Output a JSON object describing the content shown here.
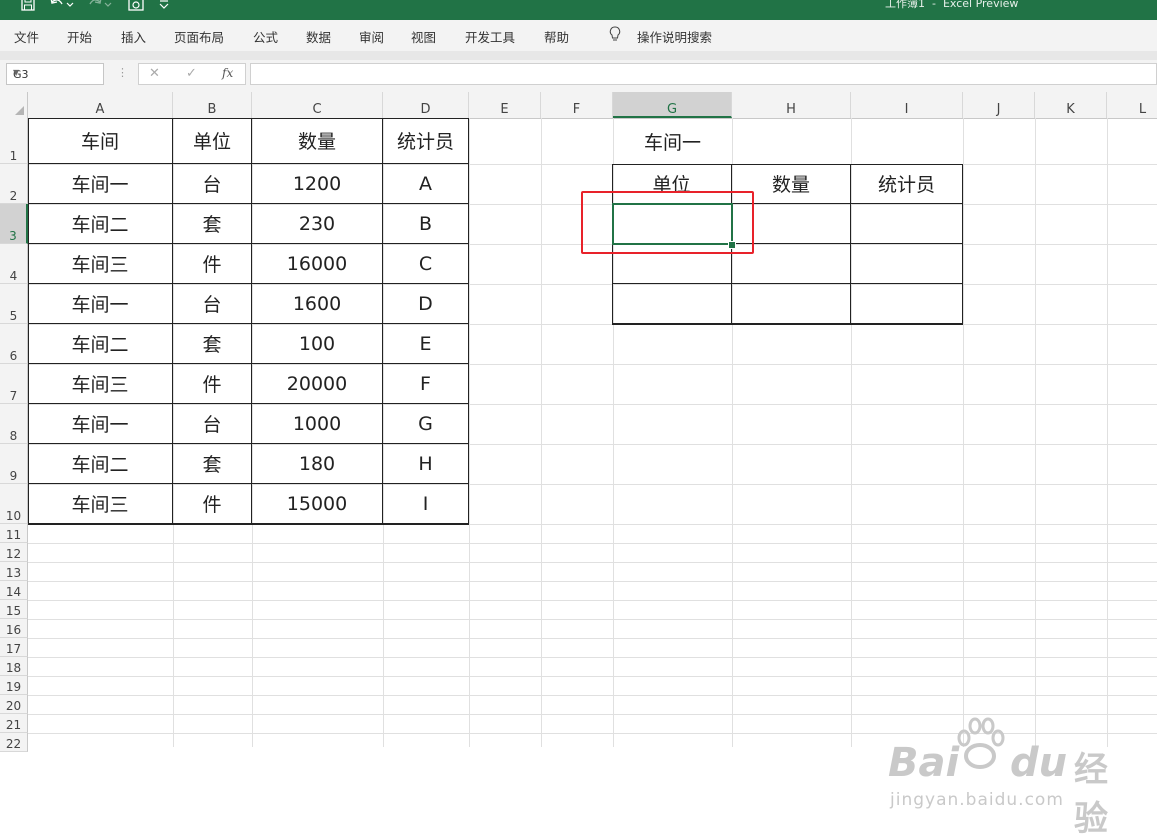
{
  "titlebar": {
    "title": "工作簿1  -  Excel Preview",
    "icons": [
      "save-icon",
      "undo-icon",
      "redo-icon",
      "camera-icon",
      "customize-icon"
    ]
  },
  "menu": {
    "items": [
      "文件",
      "开始",
      "插入",
      "页面布局",
      "公式",
      "数据",
      "审阅",
      "视图",
      "开发工具",
      "帮助"
    ],
    "search": "操作说明搜索"
  },
  "formula_bar": {
    "name_box": "G3",
    "cancel": "✕",
    "confirm": "✓",
    "fx": "fx",
    "value": ""
  },
  "columns": [
    "A",
    "B",
    "C",
    "D",
    "E",
    "F",
    "G",
    "H",
    "I",
    "J",
    "K",
    "L"
  ],
  "rows": [
    "1",
    "2",
    "3",
    "4",
    "5",
    "6",
    "7",
    "8",
    "9",
    "10",
    "11",
    "12",
    "13",
    "14",
    "15",
    "16",
    "17",
    "18",
    "19",
    "20",
    "21",
    "22"
  ],
  "selected_cell": "G3",
  "table1": {
    "headers": [
      "车间",
      "单位",
      "数量",
      "统计员"
    ],
    "rows": [
      [
        "车间一",
        "台",
        "1200",
        "A"
      ],
      [
        "车间二",
        "套",
        "230",
        "B"
      ],
      [
        "车间三",
        "件",
        "16000",
        "C"
      ],
      [
        "车间一",
        "台",
        "1600",
        "D"
      ],
      [
        "车间二",
        "套",
        "100",
        "E"
      ],
      [
        "车间三",
        "件",
        "20000",
        "F"
      ],
      [
        "车间一",
        "台",
        "1000",
        "G"
      ],
      [
        "车间二",
        "套",
        "180",
        "H"
      ],
      [
        "车间三",
        "件",
        "15000",
        "I"
      ]
    ]
  },
  "table2": {
    "title": "车间一",
    "headers": [
      "单位",
      "数量",
      "统计员"
    ]
  },
  "watermark": {
    "brand_left": "Bai",
    "brand_right": "du",
    "brand_cn": "经验",
    "url": "jingyan.baidu.com"
  },
  "colors": {
    "excel_green": "#217346",
    "highlight_red": "#e8222a"
  }
}
